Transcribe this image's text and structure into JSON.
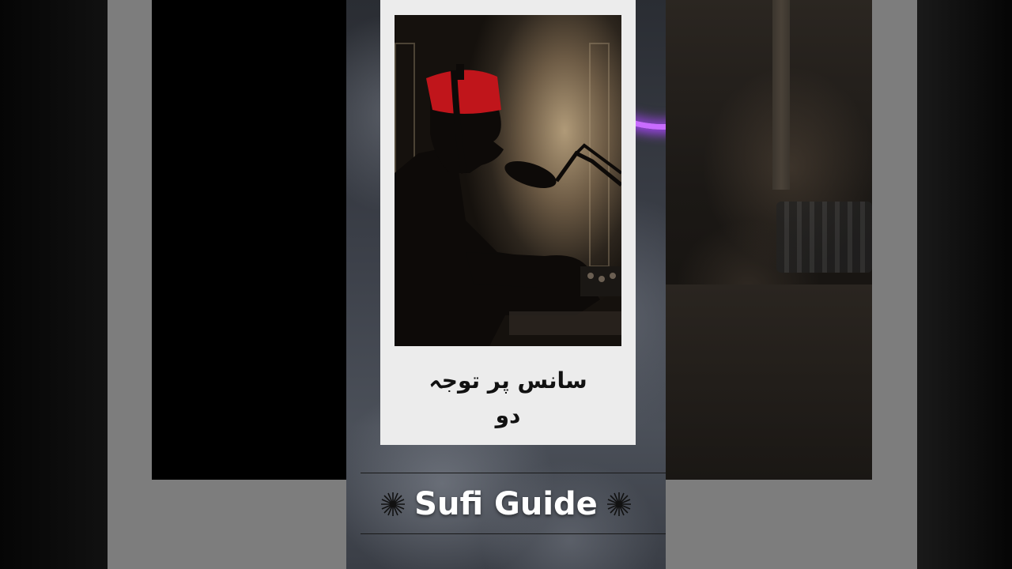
{
  "caption": {
    "line1": "سانس پر توجہ",
    "line2": "دو"
  },
  "brand": {
    "name": "Sufi Guide",
    "left_icon": "asterisk-burst-icon",
    "right_icon": "asterisk-burst-icon"
  },
  "colors": {
    "ring_glow": "#c86cff",
    "fez": "#c0151b",
    "card_bg": "#ececec",
    "brand_text": "#ffffff"
  }
}
